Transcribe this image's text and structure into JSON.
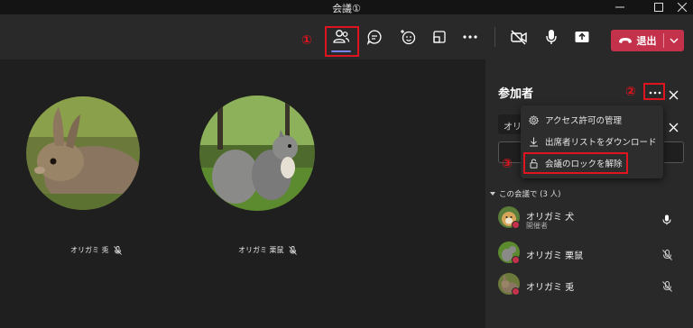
{
  "window": {
    "title": "会議①"
  },
  "toolbar": {
    "leave_label": "退出",
    "markers": {
      "one": "①",
      "two": "②",
      "three": "③"
    }
  },
  "stage": {
    "tiles": [
      {
        "name": "オリガミ 兎"
      },
      {
        "name": "オリガミ 栗鼠"
      }
    ]
  },
  "panel": {
    "title": "参加者",
    "invite_text": "オリ",
    "menu": [
      {
        "label": "アクセス許可の管理",
        "icon": "gear-icon"
      },
      {
        "label": "出席者リストをダウンロード",
        "icon": "download-icon"
      },
      {
        "label": "会議のロックを解除",
        "icon": "lock-icon"
      }
    ],
    "section_label": "この会議で (3 人)",
    "participants": [
      {
        "name": "オリガミ 犬",
        "role": "開催者",
        "mic": "on"
      },
      {
        "name": "オリガミ 栗鼠",
        "role": "",
        "mic": "off"
      },
      {
        "name": "オリガミ 兎",
        "role": "",
        "mic": "off"
      }
    ]
  },
  "colors": {
    "accent": "#7b83eb",
    "leave": "#c4314b",
    "annotation": "#e0141e"
  }
}
